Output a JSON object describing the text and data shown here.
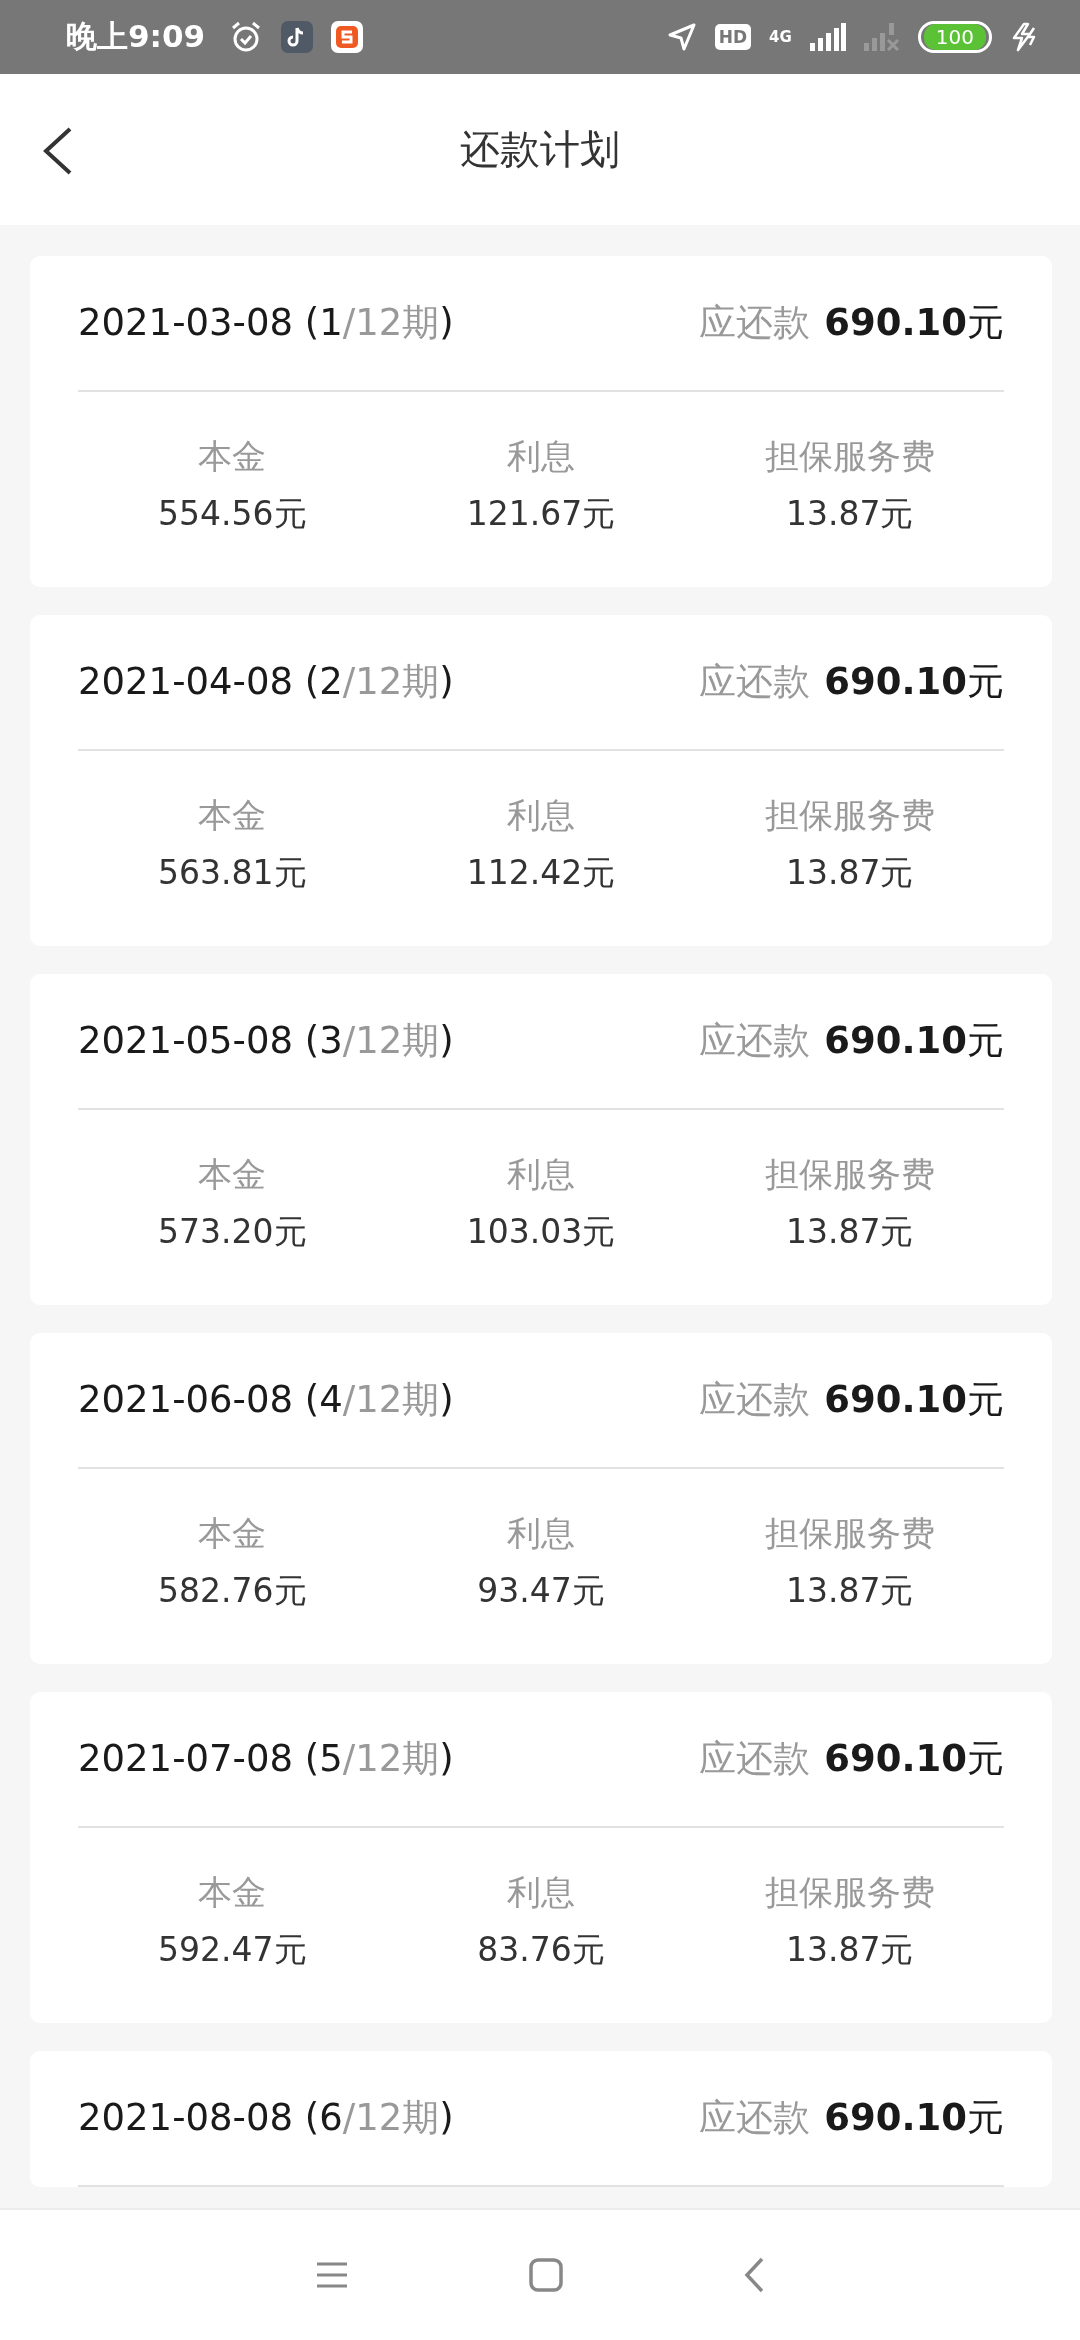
{
  "status_bar": {
    "time": "晚上9:09",
    "hd": "HD",
    "network": "4G",
    "battery": "100"
  },
  "header": {
    "title": "还款计划"
  },
  "installments": [
    {
      "date": "2021-03-08",
      "period": "(1",
      "close": ")",
      "total_periods": "/12期",
      "due_label": "应还款",
      "due_amount": "690.10",
      "unit": "元",
      "breakdown": [
        {
          "label": "本金",
          "value": "554.56元"
        },
        {
          "label": "利息",
          "value": "121.67元"
        },
        {
          "label": "担保服务费",
          "value": "13.87元"
        }
      ]
    },
    {
      "date": "2021-04-08",
      "period": "(2",
      "close": ")",
      "total_periods": "/12期",
      "due_label": "应还款",
      "due_amount": "690.10",
      "unit": "元",
      "breakdown": [
        {
          "label": "本金",
          "value": "563.81元"
        },
        {
          "label": "利息",
          "value": "112.42元"
        },
        {
          "label": "担保服务费",
          "value": "13.87元"
        }
      ]
    },
    {
      "date": "2021-05-08",
      "period": "(3",
      "close": ")",
      "total_periods": "/12期",
      "due_label": "应还款",
      "due_amount": "690.10",
      "unit": "元",
      "breakdown": [
        {
          "label": "本金",
          "value": "573.20元"
        },
        {
          "label": "利息",
          "value": "103.03元"
        },
        {
          "label": "担保服务费",
          "value": "13.87元"
        }
      ]
    },
    {
      "date": "2021-06-08",
      "period": "(4",
      "close": ")",
      "total_periods": "/12期",
      "due_label": "应还款",
      "due_amount": "690.10",
      "unit": "元",
      "breakdown": [
        {
          "label": "本金",
          "value": "582.76元"
        },
        {
          "label": "利息",
          "value": "93.47元"
        },
        {
          "label": "担保服务费",
          "value": "13.87元"
        }
      ]
    },
    {
      "date": "2021-07-08",
      "period": "(5",
      "close": ")",
      "total_periods": "/12期",
      "due_label": "应还款",
      "due_amount": "690.10",
      "unit": "元",
      "breakdown": [
        {
          "label": "本金",
          "value": "592.47元"
        },
        {
          "label": "利息",
          "value": "83.76元"
        },
        {
          "label": "担保服务费",
          "value": "13.87元"
        }
      ]
    },
    {
      "date": "2021-08-08",
      "period": "(6",
      "close": ")",
      "total_periods": "/12期",
      "due_label": "应还款",
      "due_amount": "690.10",
      "unit": "元"
    }
  ]
}
